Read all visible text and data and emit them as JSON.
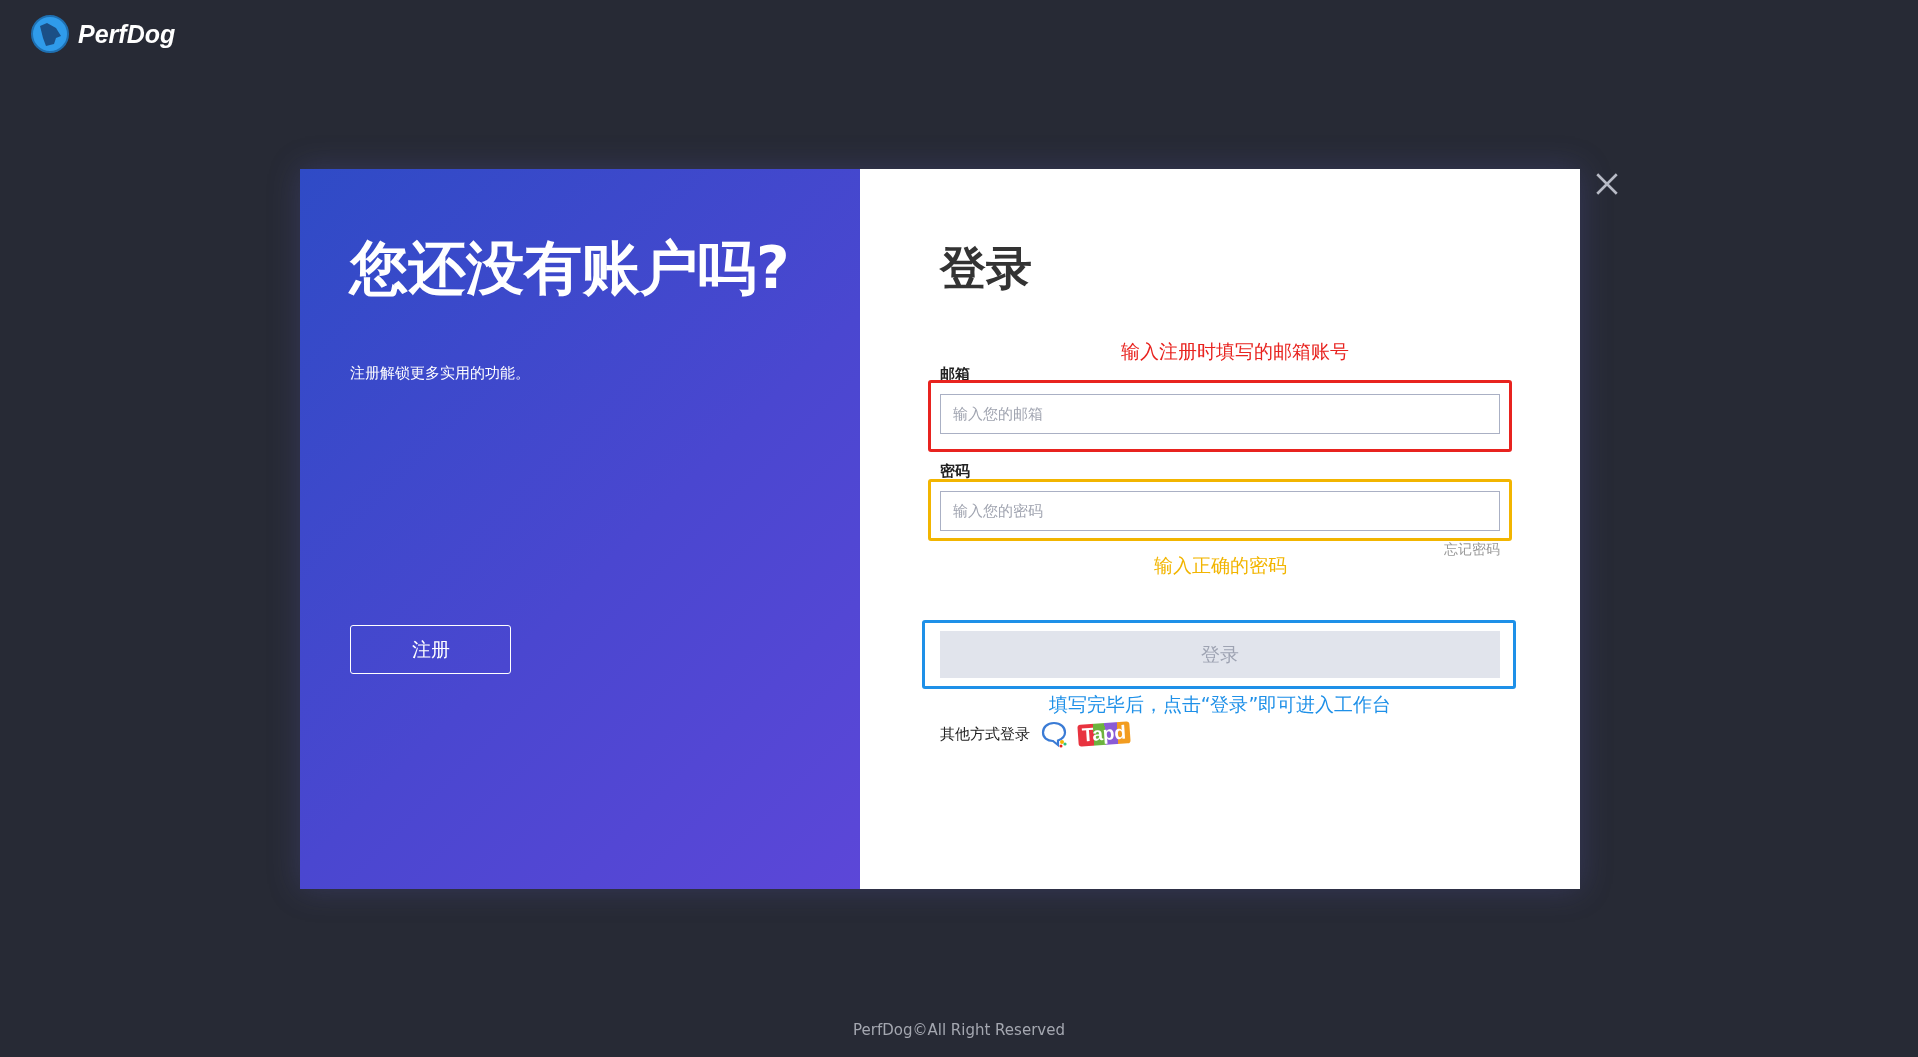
{
  "logo": {
    "text": "PerfDog"
  },
  "promo": {
    "title": "您还没有账户吗?",
    "subtitle": "注册解锁更多实用的功能。",
    "button": "注册"
  },
  "login": {
    "title": "登录",
    "fields": [
      {
        "label": "邮箱",
        "placeholder": "输入您的邮箱",
        "annotation": {
          "text": "输入注册时填写的邮箱账号",
          "color": "#e8231f"
        }
      },
      {
        "label": "密码",
        "placeholder": "输入您的密码",
        "annotation": {
          "text": "输入正确的密码",
          "color": "#f2b500"
        }
      }
    ],
    "forgot_link": "忘记密码",
    "submit": {
      "label": "登录",
      "disabled": true,
      "annotation": {
        "text": "填写完毕后，点击“登录”即可进入工作台",
        "color": "#1e90e8"
      }
    },
    "other_login": {
      "label": "其他方式登录",
      "tapd": "Tapd"
    }
  },
  "footer": "PerfDog©All Right Reserved"
}
